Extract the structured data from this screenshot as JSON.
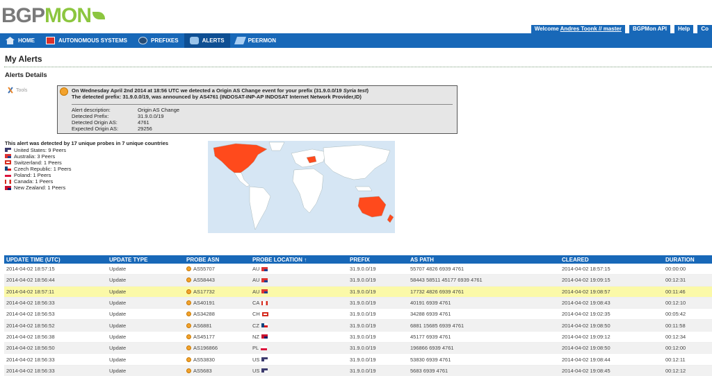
{
  "brand": {
    "logo_part1": "BGP",
    "logo_part2": "MON"
  },
  "top_links": {
    "welcome_prefix": "Welcome",
    "welcome_user": "Andres Toonk // master",
    "api": "BGPMon API",
    "help": "Help",
    "cut": "Co"
  },
  "nav": {
    "items": [
      {
        "label": "HOME",
        "icon": "home-icon"
      },
      {
        "label": "AUTONOMOUS SYSTEMS",
        "icon": "as-icon"
      },
      {
        "label": "PREFIXES",
        "icon": "globe-icon"
      },
      {
        "label": "ALERTS",
        "icon": "alerts-icon",
        "active": true
      },
      {
        "label": "PEERMON",
        "icon": "peermon-icon"
      }
    ]
  },
  "page_title": "My Alerts",
  "section_title": "Alerts Details",
  "tools_label": "Tools",
  "alert": {
    "head_part1": "On Wednesday April 2nd 2014 at 18:56 UTC we detected a Origin AS Change event for your prefix (31.9.0.0/19",
    "head_italic": "Syria test",
    "head_part2": ")",
    "head_line2": "The detected prefix: 31.9.0.0/19, was announced by AS4761 (INDOSAT-INP-AP INDOSAT Internet Network Provider,ID)",
    "details": [
      {
        "label": "Alert description:",
        "value": "Origin AS Change"
      },
      {
        "label": "Detected Prefix:",
        "value": " 31.9.0.0/19"
      },
      {
        "label": "Detected Origin AS:",
        "value": " 4761"
      },
      {
        "label": "Expected Origin AS:",
        "value": " 29256"
      }
    ]
  },
  "probes": {
    "title": "This alert was detected by 17 unique probes in 7 unique countries",
    "countries": [
      {
        "text": "United States: 9 Peers",
        "flag": "us"
      },
      {
        "text": "Australia: 3 Peers",
        "flag": "au"
      },
      {
        "text": "Switzerland: 1 Peers",
        "flag": "ch"
      },
      {
        "text": "Czech Republic: 1 Peers",
        "flag": "cz"
      },
      {
        "text": "Poland: 1 Peers",
        "flag": "pl"
      },
      {
        "text": "Canada: 1 Peers",
        "flag": "ca"
      },
      {
        "text": "New Zealand: 1 Peers",
        "flag": "nz"
      }
    ]
  },
  "map": {
    "ocean_color": "#d6e6f4",
    "land_color": "#ffffff",
    "highlight_color": "#ff4a1c"
  },
  "table": {
    "headers": [
      "UPDATE TIME (UTC)",
      "UPDATE TYPE",
      "PROBE ASN",
      "PROBE LOCATION ↑",
      "PREFIX",
      "AS PATH",
      "CLEARED",
      "DURATION"
    ],
    "rows": [
      {
        "time": "2014-04-02 18:57:15",
        "type": "Update",
        "asn": "AS55707",
        "loc": "AU",
        "flag": "au",
        "prefix": "31.9.0.0/19",
        "path": "55707 4826 6939 4761",
        "cleared": "2014-04-02 18:57:15",
        "duration": "00:00:00"
      },
      {
        "time": "2014-04-02 18:56:44",
        "type": "Update",
        "asn": "AS58443",
        "loc": "AU",
        "flag": "au",
        "prefix": "31.9.0.0/19",
        "path": "58443 58511 45177 6939 4761",
        "cleared": "2014-04-02 19:09:15",
        "duration": "00:12:31"
      },
      {
        "time": "2014-04-02 18:57:11",
        "type": "Update",
        "asn": "AS17732",
        "loc": "AU",
        "flag": "au",
        "prefix": "31.9.0.0/19",
        "path": "17732 4826 6939 4761",
        "cleared": "2014-04-02 19:08:57",
        "duration": "00:11:46",
        "highlight": true
      },
      {
        "time": "2014-04-02 18:56:33",
        "type": "Update",
        "asn": "AS40191",
        "loc": "CA",
        "flag": "ca",
        "prefix": "31.9.0.0/19",
        "path": "40191 6939 4761",
        "cleared": "2014-04-02 19:08:43",
        "duration": "00:12:10"
      },
      {
        "time": "2014-04-02 18:56:53",
        "type": "Update",
        "asn": "AS34288",
        "loc": "CH",
        "flag": "ch",
        "prefix": "31.9.0.0/19",
        "path": "34288 6939 4761",
        "cleared": "2014-04-02 19:02:35",
        "duration": "00:05:42"
      },
      {
        "time": "2014-04-02 18:56:52",
        "type": "Update",
        "asn": "AS6881",
        "loc": "CZ",
        "flag": "cz",
        "prefix": "31.9.0.0/19",
        "path": "6881 15685 6939 4761",
        "cleared": "2014-04-02 19:08:50",
        "duration": "00:11:58"
      },
      {
        "time": "2014-04-02 18:56:38",
        "type": "Update",
        "asn": "AS45177",
        "loc": "NZ",
        "flag": "nz",
        "prefix": "31.9.0.0/19",
        "path": "45177 6939 4761",
        "cleared": "2014-04-02 19:09:12",
        "duration": "00:12:34"
      },
      {
        "time": "2014-04-02 18:56:50",
        "type": "Update",
        "asn": "AS196866",
        "loc": "PL",
        "flag": "pl",
        "prefix": "31.9.0.0/19",
        "path": "196866 6939 4761",
        "cleared": "2014-04-02 19:08:50",
        "duration": "00:12:00"
      },
      {
        "time": "2014-04-02 18:56:33",
        "type": "Update",
        "asn": "AS53830",
        "loc": "US",
        "flag": "us",
        "prefix": "31.9.0.0/19",
        "path": "53830 6939 4761",
        "cleared": "2014-04-02 19:08:44",
        "duration": "00:12:11"
      },
      {
        "time": "2014-04-02 18:56:33",
        "type": "Update",
        "asn": "AS5683",
        "loc": "US",
        "flag": "us",
        "prefix": "31.9.0.0/19",
        "path": "5683 6939 4761",
        "cleared": "2014-04-02 19:08:45",
        "duration": "00:12:12"
      }
    ]
  }
}
